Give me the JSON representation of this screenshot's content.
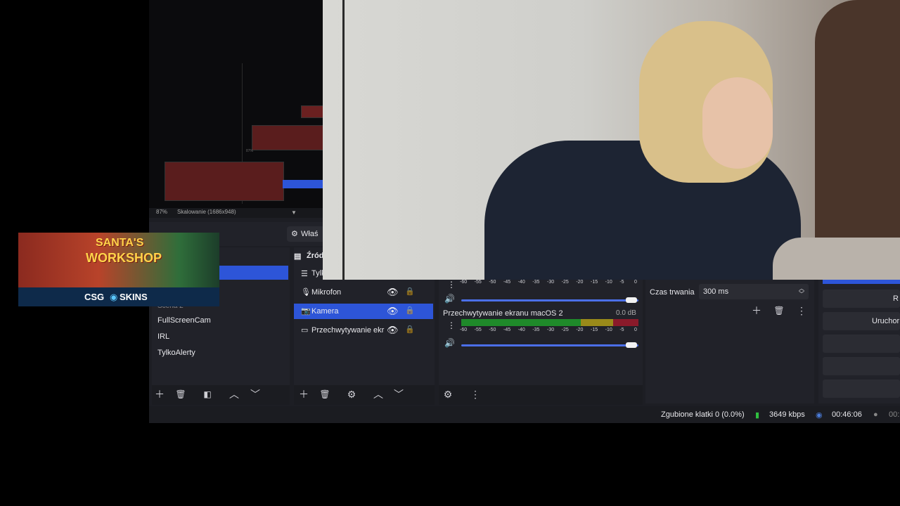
{
  "preview": {
    "zoom_label": "87%",
    "scaling_label": "Skalowanie (1686x948)",
    "nested_zoom": "87%",
    "nested_scaling": "Skalowanie (1686x948)"
  },
  "overlay_banner": {
    "title_line1": "SANTA'S",
    "title_line2": "WORKSHOP",
    "brand": "CSG",
    "brand_suffix": "SKINS"
  },
  "properties_button": "Właś",
  "scenes": {
    "partial_items": [
      "Kamera",
      "Scena 2"
    ],
    "items": [
      "FullScreenCam",
      "IRL",
      "TylkoAlerty"
    ]
  },
  "sources": {
    "header": "Źród",
    "partial_top": "Tylk",
    "items": [
      {
        "label": "Mikrofon",
        "icon": "microphone-icon",
        "selected": false
      },
      {
        "label": "Kamera",
        "icon": "camera-icon",
        "selected": true
      },
      {
        "label": "Przechwytywanie ekr",
        "icon": "monitor-icon",
        "selected": false
      }
    ]
  },
  "mixer": {
    "scale": [
      "-60",
      "-55",
      "-50",
      "-45",
      "-40",
      "-35",
      "-30",
      "-25",
      "-20",
      "-15",
      "-10",
      "-5",
      "0"
    ],
    "channel2_name": "Przechwytywanie ekranu macOS 2",
    "channel2_db": "0.0 dB",
    "channel1_level": 1,
    "channel2_level": 1
  },
  "transitions": {
    "duration_label": "Czas trwania",
    "duration_value": "300 ms"
  },
  "controls": {
    "partial_button_1": "R",
    "partial_button_2": "Uruchor"
  },
  "status": {
    "dropped_frames": "Zgubione klatki 0 (0.0%)",
    "bitrate": "3649 kbps",
    "stream_time": "00:46:06",
    "record_time": "00:"
  },
  "colors": {
    "accent": "#2d55d8",
    "panel": "#212229",
    "meter_green": "#1f8a2a",
    "meter_yellow": "#9a8a1a",
    "meter_red": "#8a1a2a"
  }
}
